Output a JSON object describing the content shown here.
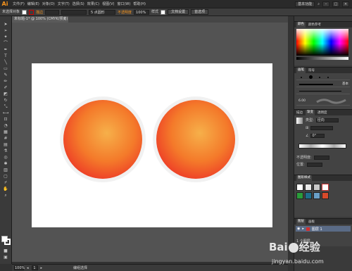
{
  "app": {
    "logo": "Ai"
  },
  "menu": {
    "items": [
      "文件(F)",
      "编辑(E)",
      "对象(O)",
      "文字(T)",
      "选择(S)",
      "效果(C)",
      "视图(V)",
      "窗口(W)",
      "帮助(H)"
    ],
    "workspace": "基本功能",
    "search_icon": "search-icon"
  },
  "control_bar": {
    "label_selection": "未选择对象",
    "link_stroke": "描边",
    "stroke_value": "5 点圆形",
    "opacity_link": "不透明度",
    "opacity_value": "100%",
    "style_label": "样式",
    "doc_setup_btn": "文档设置",
    "prefs_btn": "首选项"
  },
  "document_tab": {
    "title": "未标题-1* @ 100% (CMYK/预览)",
    "close": "×"
  },
  "status_bar": {
    "zoom": "100%",
    "page": "1",
    "status": "编组选择"
  },
  "panels": {
    "color_tabs": [
      "颜色",
      "颜色参考"
    ],
    "brush_tabs": [
      "画笔",
      "符号"
    ],
    "brush_basic": "基本",
    "brush_size": "6.00",
    "stroke_tabs": [
      "描边",
      "渐变",
      "透明度"
    ],
    "gradient_type_label": "类型:",
    "gradient_type": "径向",
    "gradient_angle": "0°",
    "gradient_opacity_label": "不透明度:",
    "gradient_position_label": "位置:",
    "graphic_styles_tabs": [
      "图形样式"
    ],
    "layers_tabs": [
      "图层",
      "画板"
    ],
    "layer_name": "图层 1",
    "layer_count": "1 个图层"
  },
  "artwork": {
    "circle_count": 2
  },
  "colors": {
    "accent": "#f7941d",
    "ball_center": "#f6b04a",
    "ball_edge": "#e8271f"
  },
  "watermark": {
    "brand_left": "Bai",
    "brand_right": "经验",
    "url": "jingyan.baidu.com"
  }
}
